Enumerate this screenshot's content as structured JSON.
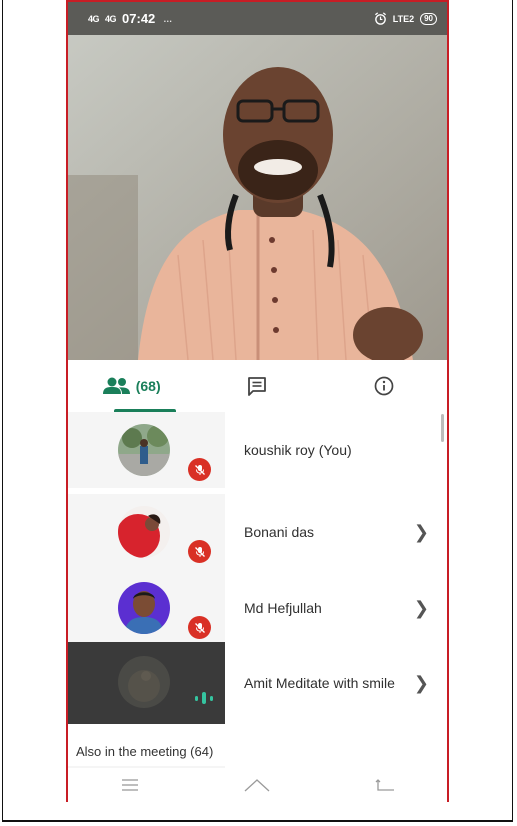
{
  "status_bar": {
    "signal1": "4G",
    "signal2": "4G",
    "time": "07:42",
    "extra": "…",
    "right_text": "LTE2",
    "battery": "90"
  },
  "tabs": {
    "people_count": "(68)",
    "people_icon": "people-icon",
    "chat_icon": "chat-icon",
    "info_icon": "info-icon"
  },
  "participants": [
    {
      "name": "koushik roy (You)",
      "muted": true
    },
    {
      "name": "Bonani das",
      "muted": true
    },
    {
      "name": "Md Hefjullah",
      "muted": true
    },
    {
      "name": "Amit Meditate with smile",
      "speaking": true
    }
  ],
  "section": {
    "also_label": "Also in the meeting (64)"
  },
  "colors": {
    "accent": "#1a7f5a",
    "muted_badge": "#d93025",
    "status_bar": "#5b5b57",
    "frame": "#c81d25"
  }
}
